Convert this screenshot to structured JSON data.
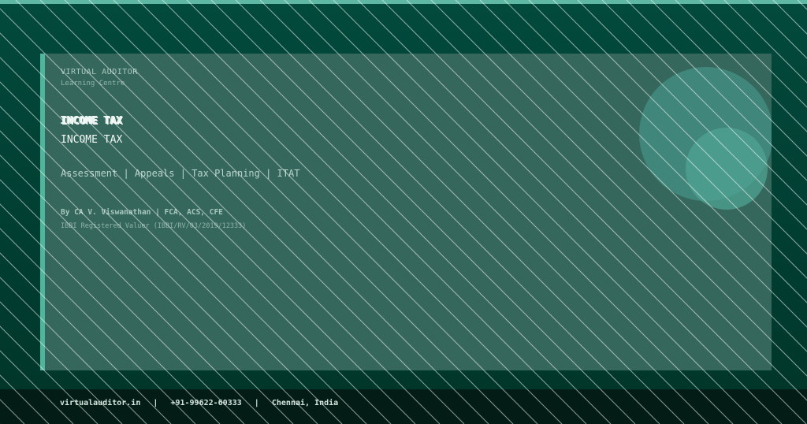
{
  "brand": {
    "name": "VIRTUAL AUDITOR",
    "tagline": "Learning Centre"
  },
  "hero": {
    "title_top": "INCOME TAX",
    "title": "INCOME TAX",
    "topics": "Assessment | Appeals | Tax Planning | ITAT"
  },
  "author": {
    "byline": "By CA V. Viswanathan | FCA, ACS, CFE",
    "registration": "IBBI Registered Valuer (IBBI/RV/03/2019/12333)"
  },
  "footer": {
    "website": "virtualauditor.in",
    "separator": "|",
    "phone": "+91-99622-60333",
    "location": "Chennai, India"
  },
  "colors": {
    "background": "#013f33",
    "card": "#36675c",
    "accent": "#4db69c",
    "footer": "#031c15"
  }
}
